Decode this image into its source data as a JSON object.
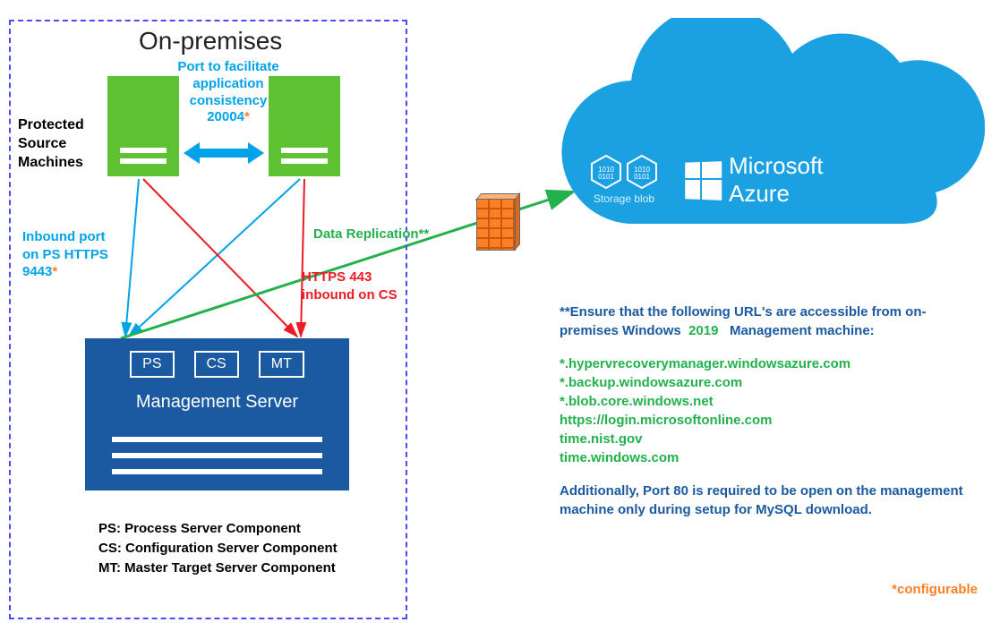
{
  "onprem": {
    "title": "On-premises",
    "port_app_line1": "Port to facilitate",
    "port_app_line2": "application",
    "port_app_line3": "consistency",
    "port_app_port": "20004",
    "protected_l1": "Protected",
    "protected_l2": "Source",
    "protected_l3": "Machines",
    "inbound_l1": "Inbound port",
    "inbound_l2": "on PS HTTPS",
    "inbound_port": "9443",
    "https443_l1": "HTTPS 443",
    "https443_l2": "inbound on CS",
    "mgmt_ps": "PS",
    "mgmt_cs": "CS",
    "mgmt_mt": "MT",
    "mgmt_label": "Management Server",
    "legend_l1": "PS: Process Server Component",
    "legend_l2": "CS: Configuration Server Component",
    "legend_l3": "MT: Master Target Server Component",
    "configurable": "*configurable"
  },
  "mid": {
    "data_repl": "Data Replication**"
  },
  "cloud": {
    "blob_label": "Storage blob",
    "azure_brand1": "Microsoft",
    "azure_brand2": "Azure"
  },
  "notes": {
    "hdr_a": "**Ensure that the following URL's are accessible from on-premises Windows",
    "year": "2019",
    "hdr_b": "Management machine:",
    "url1": "*.hypervrecoverymanager.windowsazure.com",
    "url2": "*.backup.windowsazure.com",
    "url3": "*.blob.core.windows.net",
    "url4": "https://login.microsoftonline.com",
    "url5": "time.nist.gov",
    "url6": "time.windows.com",
    "foot": "Additionally, Port 80 is required to be open on the management machine only during setup for MySQL download."
  }
}
